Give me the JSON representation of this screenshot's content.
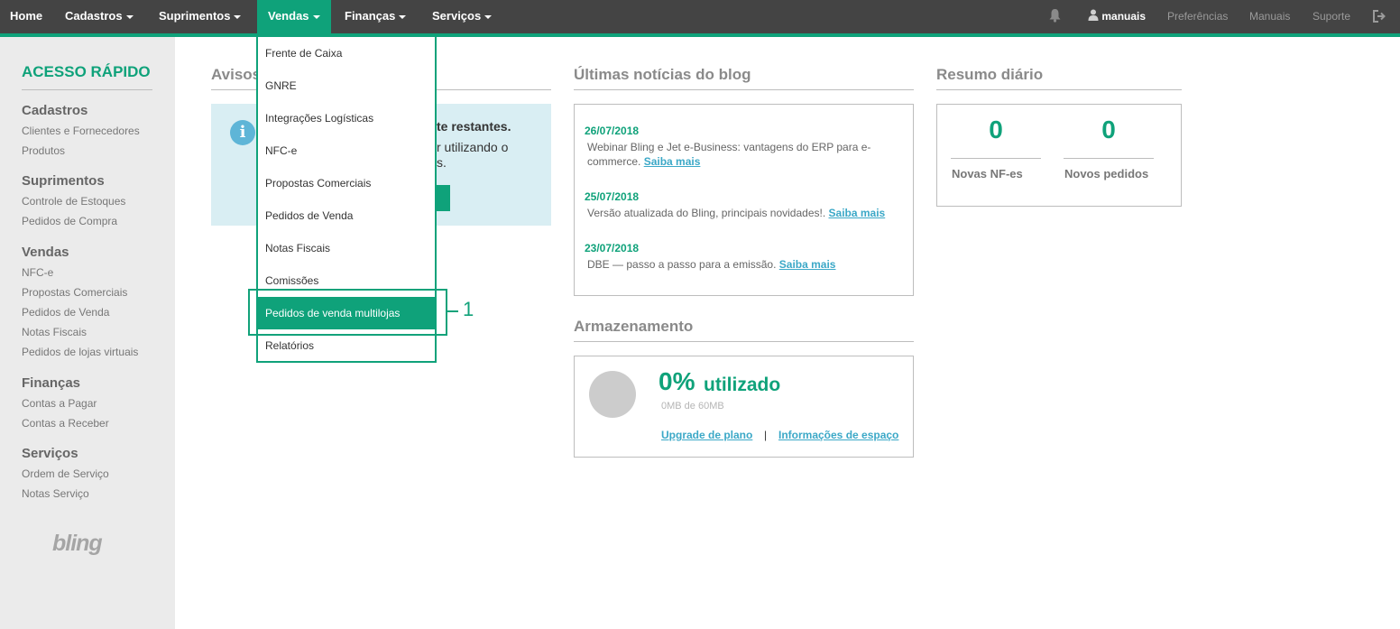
{
  "topnav": {
    "items": [
      "Home",
      "Cadastros",
      "Suprimentos",
      "Vendas",
      "Finanças",
      "Serviços"
    ],
    "user": "manuais",
    "right": [
      "Preferências",
      "Manuais",
      "Suporte"
    ],
    "icons": [
      "bell-icon",
      "user-icon",
      "logout-icon"
    ]
  },
  "sidebar": {
    "title": "ACESSO RÁPIDO",
    "sections": [
      {
        "heading": "Cadastros",
        "links": [
          "Clientes e Fornecedores",
          "Produtos"
        ]
      },
      {
        "heading": "Suprimentos",
        "links": [
          "Controle de Estoques",
          "Pedidos de Compra"
        ]
      },
      {
        "heading": "Vendas",
        "links": [
          "NFC-e",
          "Propostas Comerciais",
          "Pedidos de Venda",
          "Notas Fiscais",
          "Pedidos de lojas virtuais"
        ]
      },
      {
        "heading": "Finanças",
        "links": [
          "Contas a Pagar",
          "Contas a Receber"
        ]
      },
      {
        "heading": "Serviços",
        "links": [
          "Ordem de Serviço",
          "Notas Serviço"
        ]
      }
    ],
    "logo": "bling"
  },
  "dropdown": {
    "items": [
      "Frente de Caixa",
      "GNRE",
      "Integrações Logísticas",
      "NFC-e",
      "Propostas Comerciais",
      "Pedidos de Venda",
      "Notas Fiscais",
      "Comissões",
      "Pedidos de venda multilojas",
      "Relatórios"
    ],
    "highlighted": "Pedidos de venda multilojas"
  },
  "annotation": {
    "number": "1"
  },
  "avisos": {
    "title": "Avisos",
    "bold_text": "te restantes.",
    "text_line1": "r utilizando o",
    "text_line2": "s."
  },
  "blog": {
    "title": "Últimas notícias do blog",
    "posts": [
      {
        "date": "26/07/2018",
        "text": "Webinar Bling e Jet e-Business: vantagens do ERP para e-commerce.",
        "link": "Saiba mais"
      },
      {
        "date": "25/07/2018",
        "text": "Versão atualizada do Bling, principais novidades!.",
        "link": "Saiba mais"
      },
      {
        "date": "23/07/2018",
        "text": "DBE — passo a passo para a emissão.",
        "link": "Saiba mais"
      }
    ]
  },
  "storage": {
    "title": "Armazenamento",
    "percent": "0%",
    "used_label": "utilizado",
    "size": "0MB de 60MB",
    "upgrade_link": "Upgrade de plano",
    "separator": "|",
    "info_link": "Informações de espaço"
  },
  "resumo": {
    "title": "Resumo diário",
    "items": [
      {
        "value": "0",
        "label": "Novas NF-es"
      },
      {
        "value": "0",
        "label": "Novos pedidos"
      }
    ]
  },
  "colors": {
    "accent": "#0fa27a",
    "nav_bg": "#444444",
    "sidebar_bg": "#ebebeb",
    "link": "#3ba8c7",
    "info_bg": "#d9eef3"
  }
}
